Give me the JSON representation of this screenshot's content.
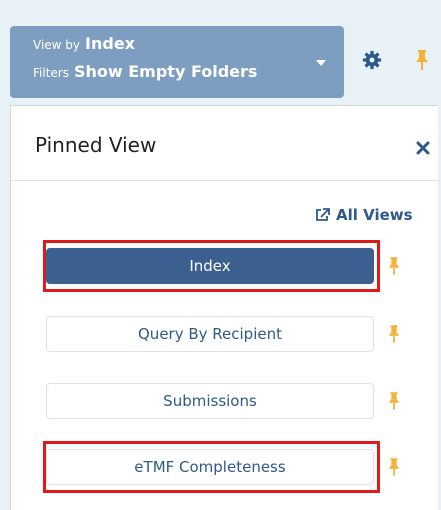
{
  "header": {
    "view_by_label": "View by",
    "view_by_value": "Index",
    "filters_label": "Filters",
    "filters_value": "Show Empty Folders",
    "text_color": "#ffffff",
    "bg_color": "#7d9ec1"
  },
  "icons": {
    "settings": "gear-icon",
    "pin": "pushpin-icon",
    "close": "close-icon",
    "external": "external-link-icon"
  },
  "panel": {
    "title": "Pinned View",
    "all_views_label": "All Views"
  },
  "views": [
    {
      "label": "Index",
      "active": true,
      "highlighted": true
    },
    {
      "label": "Query By Recipient",
      "active": false,
      "highlighted": false
    },
    {
      "label": "Submissions",
      "active": false,
      "highlighted": false
    },
    {
      "label": "eTMF Completeness",
      "active": false,
      "highlighted": true
    }
  ],
  "colors": {
    "pin": "#f3b13a",
    "link": "#2e5a8a",
    "active_button": "#3b5f8f",
    "highlight": "#e01a1a"
  }
}
